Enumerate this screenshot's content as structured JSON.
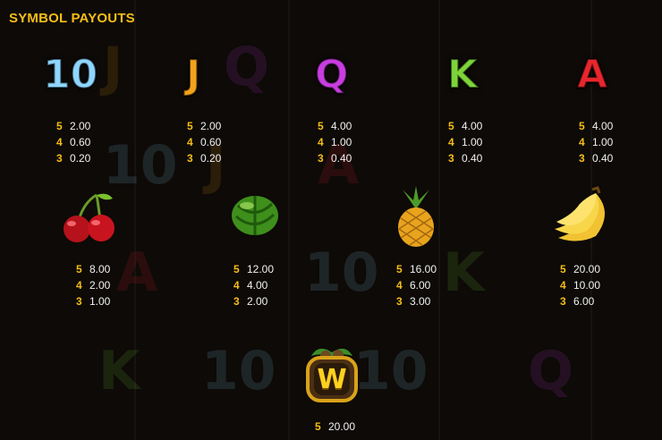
{
  "title": "SYMBOL PAYOUTS",
  "background_symbols": [
    "J",
    "Q",
    "10",
    "J",
    "A",
    "A",
    "10",
    "K",
    "K",
    "10",
    "10",
    "Q"
  ],
  "symbols": [
    {
      "name": "10",
      "label": "10",
      "color": "#8fd6ff",
      "payouts": [
        {
          "count": "5",
          "value": "2.00"
        },
        {
          "count": "4",
          "value": "0.60"
        },
        {
          "count": "3",
          "value": "0.20"
        }
      ]
    },
    {
      "name": "J",
      "label": "J",
      "color": "#f4a21b",
      "payouts": [
        {
          "count": "5",
          "value": "2.00"
        },
        {
          "count": "4",
          "value": "0.60"
        },
        {
          "count": "3",
          "value": "0.20"
        }
      ]
    },
    {
      "name": "Q",
      "label": "Q",
      "color": "#c83de0",
      "payouts": [
        {
          "count": "5",
          "value": "4.00"
        },
        {
          "count": "4",
          "value": "1.00"
        },
        {
          "count": "3",
          "value": "0.40"
        }
      ]
    },
    {
      "name": "K",
      "label": "K",
      "color": "#7dd43a",
      "payouts": [
        {
          "count": "5",
          "value": "4.00"
        },
        {
          "count": "4",
          "value": "1.00"
        },
        {
          "count": "3",
          "value": "0.40"
        }
      ]
    },
    {
      "name": "A",
      "label": "A",
      "color": "#e8262d",
      "payouts": [
        {
          "count": "5",
          "value": "4.00"
        },
        {
          "count": "4",
          "value": "1.00"
        },
        {
          "count": "3",
          "value": "0.40"
        }
      ]
    },
    {
      "name": "cherries",
      "payouts": [
        {
          "count": "5",
          "value": "8.00"
        },
        {
          "count": "4",
          "value": "2.00"
        },
        {
          "count": "3",
          "value": "1.00"
        }
      ]
    },
    {
      "name": "watermelon",
      "payouts": [
        {
          "count": "5",
          "value": "12.00"
        },
        {
          "count": "4",
          "value": "4.00"
        },
        {
          "count": "3",
          "value": "2.00"
        }
      ]
    },
    {
      "name": "pineapple",
      "payouts": [
        {
          "count": "5",
          "value": "16.00"
        },
        {
          "count": "4",
          "value": "6.00"
        },
        {
          "count": "3",
          "value": "3.00"
        }
      ]
    },
    {
      "name": "bananas",
      "payouts": [
        {
          "count": "5",
          "value": "20.00"
        },
        {
          "count": "4",
          "value": "10.00"
        },
        {
          "count": "3",
          "value": "6.00"
        }
      ]
    },
    {
      "name": "wild",
      "label": "W",
      "payouts": [
        {
          "count": "5",
          "value": "20.00"
        }
      ]
    }
  ]
}
